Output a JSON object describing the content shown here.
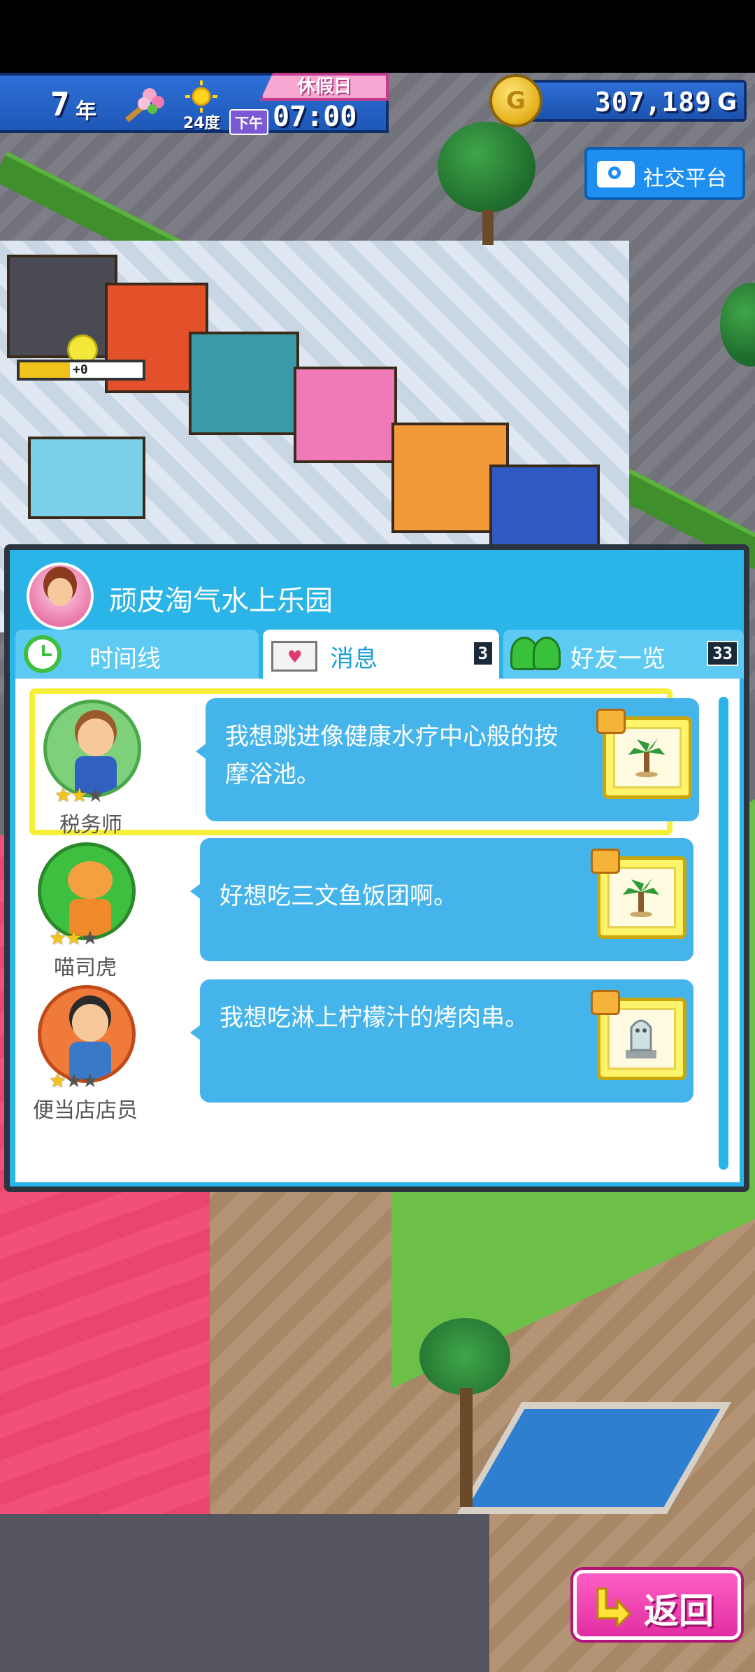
{
  "hud": {
    "year": "7",
    "year_unit": "年",
    "temperature": "24度",
    "ampm": "下午",
    "time": "07:00",
    "day_type": "休假日",
    "money": "307,189",
    "money_unit": "G",
    "coin_letter": "G",
    "social_button": "社交平台",
    "mood_value": "+0",
    "mood_level": 0.45
  },
  "panel": {
    "park_name": "顽皮淘气水上乐园",
    "tabs": [
      {
        "label": "时间线",
        "icon": "clock-icon",
        "count": ""
      },
      {
        "label": "消息",
        "icon": "envelope-icon",
        "count": "3"
      },
      {
        "label": "好友一览",
        "icon": "friends-icon",
        "count": "33"
      }
    ],
    "active_tab": 1,
    "messages": [
      {
        "name": "税务师",
        "text": "我想跳进像健康水疗中心般的按摩浴池。",
        "stars": 2,
        "gift_icon": "palm-tree-icon",
        "portrait_bg": "#7fd07a",
        "body_color": "#3060c0"
      },
      {
        "name": "喵司虎",
        "text": "好想吃三文鱼饭团啊。",
        "stars": 2,
        "gift_icon": "palm-tree-icon",
        "portrait_bg": "#3fbf3f",
        "body_color": "#f08a2a"
      },
      {
        "name": "便当店店员",
        "text": "我想吃淋上柠檬汁的烤肉串。",
        "stars": 1,
        "gift_icon": "ghost-statue-icon",
        "portrait_bg": "#f07a3a",
        "body_color": "#3a78c8"
      }
    ]
  },
  "return_button": "返回",
  "colors": {
    "panel_blue": "#2ab4e8",
    "bubble_blue": "#45b4ea",
    "highlight_yellow": "#f5ef3a",
    "return_pink": "#e22ea3"
  }
}
